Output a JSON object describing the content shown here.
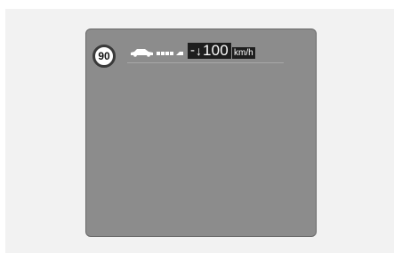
{
  "speed_limit": {
    "value": "90",
    "icon": "speed-limit-sign-icon"
  },
  "vehicle": {
    "icon": "car-following-distance-icon"
  },
  "target": {
    "minus": "-",
    "arrow": "↓",
    "value": "100",
    "unit": "km/h"
  },
  "colors": {
    "display_bg": "#8c8c8c",
    "text_box_bg": "#1e1e1e",
    "text": "#ffffff"
  }
}
